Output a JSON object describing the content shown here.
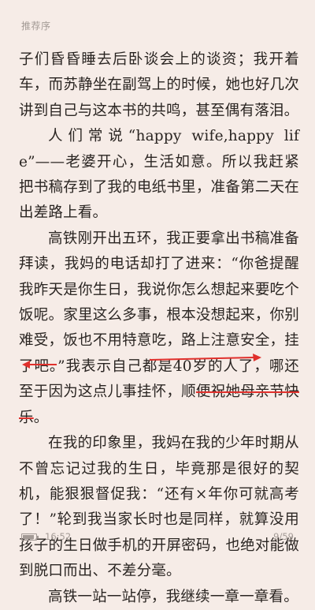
{
  "header": {
    "title": "推荐序"
  },
  "content": {
    "p1": "子们昏昏睡去后卧谈会上的谈资；我开着车，而苏静坐在副驾上的时候，她也好几次讲到自己与这本书的共鸣，甚至偶有落泪。",
    "p2": "人们常说“happy wife,happy life”——老婆开心，生活如意。所以我赶紧把书稿存到了我的电纸书里，准备第二天在出差路上看。",
    "p3_before": "高铁刚开出五环，我正要拿出书稿准备拜读，我妈的电话却打了进来：“你爸提醒我昨天是你生日，我说你怎么想起来要吃个饭呢。家里这么多事，根本没想起来，你别难受，饭也不用特意吃，路上注意安全，挂了吧。”我表示自己都是40岁的人了，哪还至于因为这点儿事挂怀，顺",
    "p3_struck": "便祝她母亲节快乐",
    "p3_after": "。",
    "p4": "在我的印象里，我妈在我的少年时期从不曾忘记过我的生日，毕竟那是很好的契机，能狠狠督促我：“还有×年你可就高考了！”轮到我当家长时也是同样，就算没用孩子的生日做手机的开屏密码，也绝对能做到脱口而出、不差分毫。",
    "p5": "高铁一站一站停，我继续一章一章看。"
  },
  "annotation": {
    "color": "#e0302c"
  },
  "footer": {
    "battery_level": 0.9,
    "time": "16:52",
    "page": "9/59"
  }
}
